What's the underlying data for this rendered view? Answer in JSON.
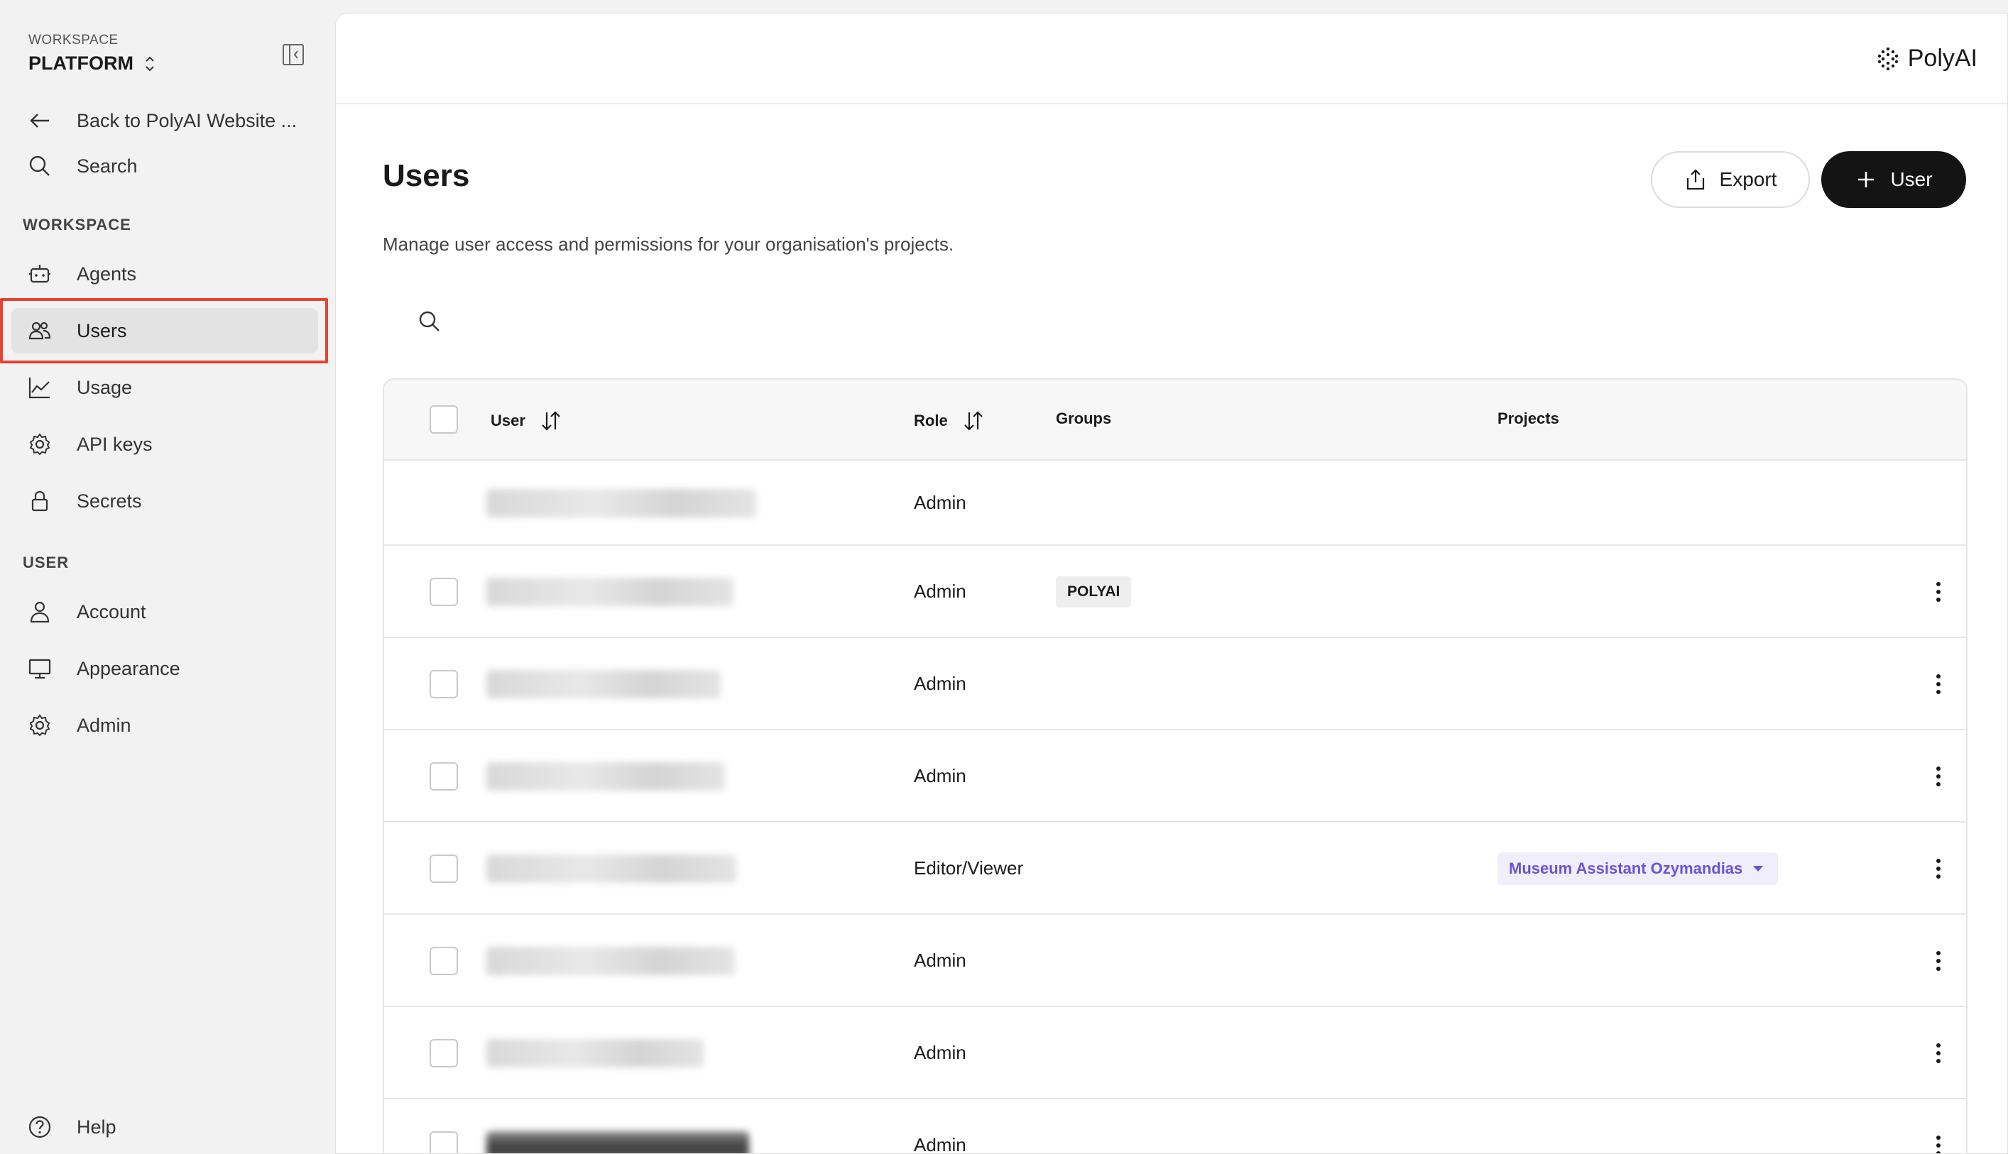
{
  "sidebar": {
    "workspace_caption": "WORKSPACE",
    "workspace_name": "PLATFORM",
    "back_label": "Back to PolyAI Website ...",
    "search_label": "Search",
    "section_workspace": "WORKSPACE",
    "section_user": "USER",
    "items": [
      {
        "label": "Agents",
        "icon": "robot-icon"
      },
      {
        "label": "Users",
        "icon": "users-icon",
        "active": true
      },
      {
        "label": "Usage",
        "icon": "chart-line-icon"
      },
      {
        "label": "API keys",
        "icon": "gear-icon"
      },
      {
        "label": "Secrets",
        "icon": "lock-icon"
      },
      {
        "label": "Account",
        "icon": "person-icon"
      },
      {
        "label": "Appearance",
        "icon": "monitor-icon"
      },
      {
        "label": "Admin",
        "icon": "gear-icon"
      }
    ],
    "help_label": "Help"
  },
  "header": {
    "logo_text": "PolyAI"
  },
  "page": {
    "title": "Users",
    "subtitle": "Manage user access and permissions for your organisation's projects.",
    "export_label": "Export",
    "add_user_label": "User"
  },
  "table": {
    "columns": {
      "user": "User",
      "role": "Role",
      "groups": "Groups",
      "projects": "Projects"
    },
    "rows": [
      {
        "role": "Admin",
        "group": "",
        "project": ""
      },
      {
        "role": "Admin",
        "group": "POLYAI",
        "project": ""
      },
      {
        "role": "Admin",
        "group": "",
        "project": ""
      },
      {
        "role": "Admin",
        "group": "",
        "project": ""
      },
      {
        "role": "Editor/Viewer",
        "group": "",
        "project": "Museum Assistant Ozymandias"
      },
      {
        "role": "Admin",
        "group": "",
        "project": ""
      },
      {
        "role": "Admin",
        "group": "",
        "project": ""
      },
      {
        "role": "Admin",
        "group": "",
        "project": ""
      }
    ]
  },
  "colors": {
    "accent_highlight": "#e8432e",
    "primary_button": "#141414",
    "project_tag_text": "#6a53d6"
  }
}
